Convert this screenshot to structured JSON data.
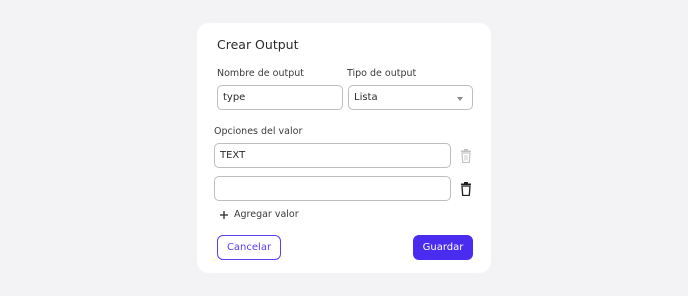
{
  "dialog": {
    "title": "Crear Output",
    "output_name_label": "Nombre de output",
    "output_name_value": "type",
    "output_type_label": "Tipo de output",
    "output_type_value": "Lista",
    "options_label": "Opciones del valor",
    "options": [
      {
        "value": "TEXT",
        "delete_enabled": false
      },
      {
        "value": "",
        "delete_enabled": true
      }
    ],
    "add_value_label": "Agregar valor",
    "cancel_label": "Cancelar",
    "save_label": "Guardar"
  },
  "colors": {
    "accent": "#4a2cf0",
    "background": "#f3f3f5",
    "card": "#ffffff"
  },
  "icons": {
    "delete": "trash-icon",
    "add": "plus-icon",
    "select": "chevron-down-icon"
  }
}
